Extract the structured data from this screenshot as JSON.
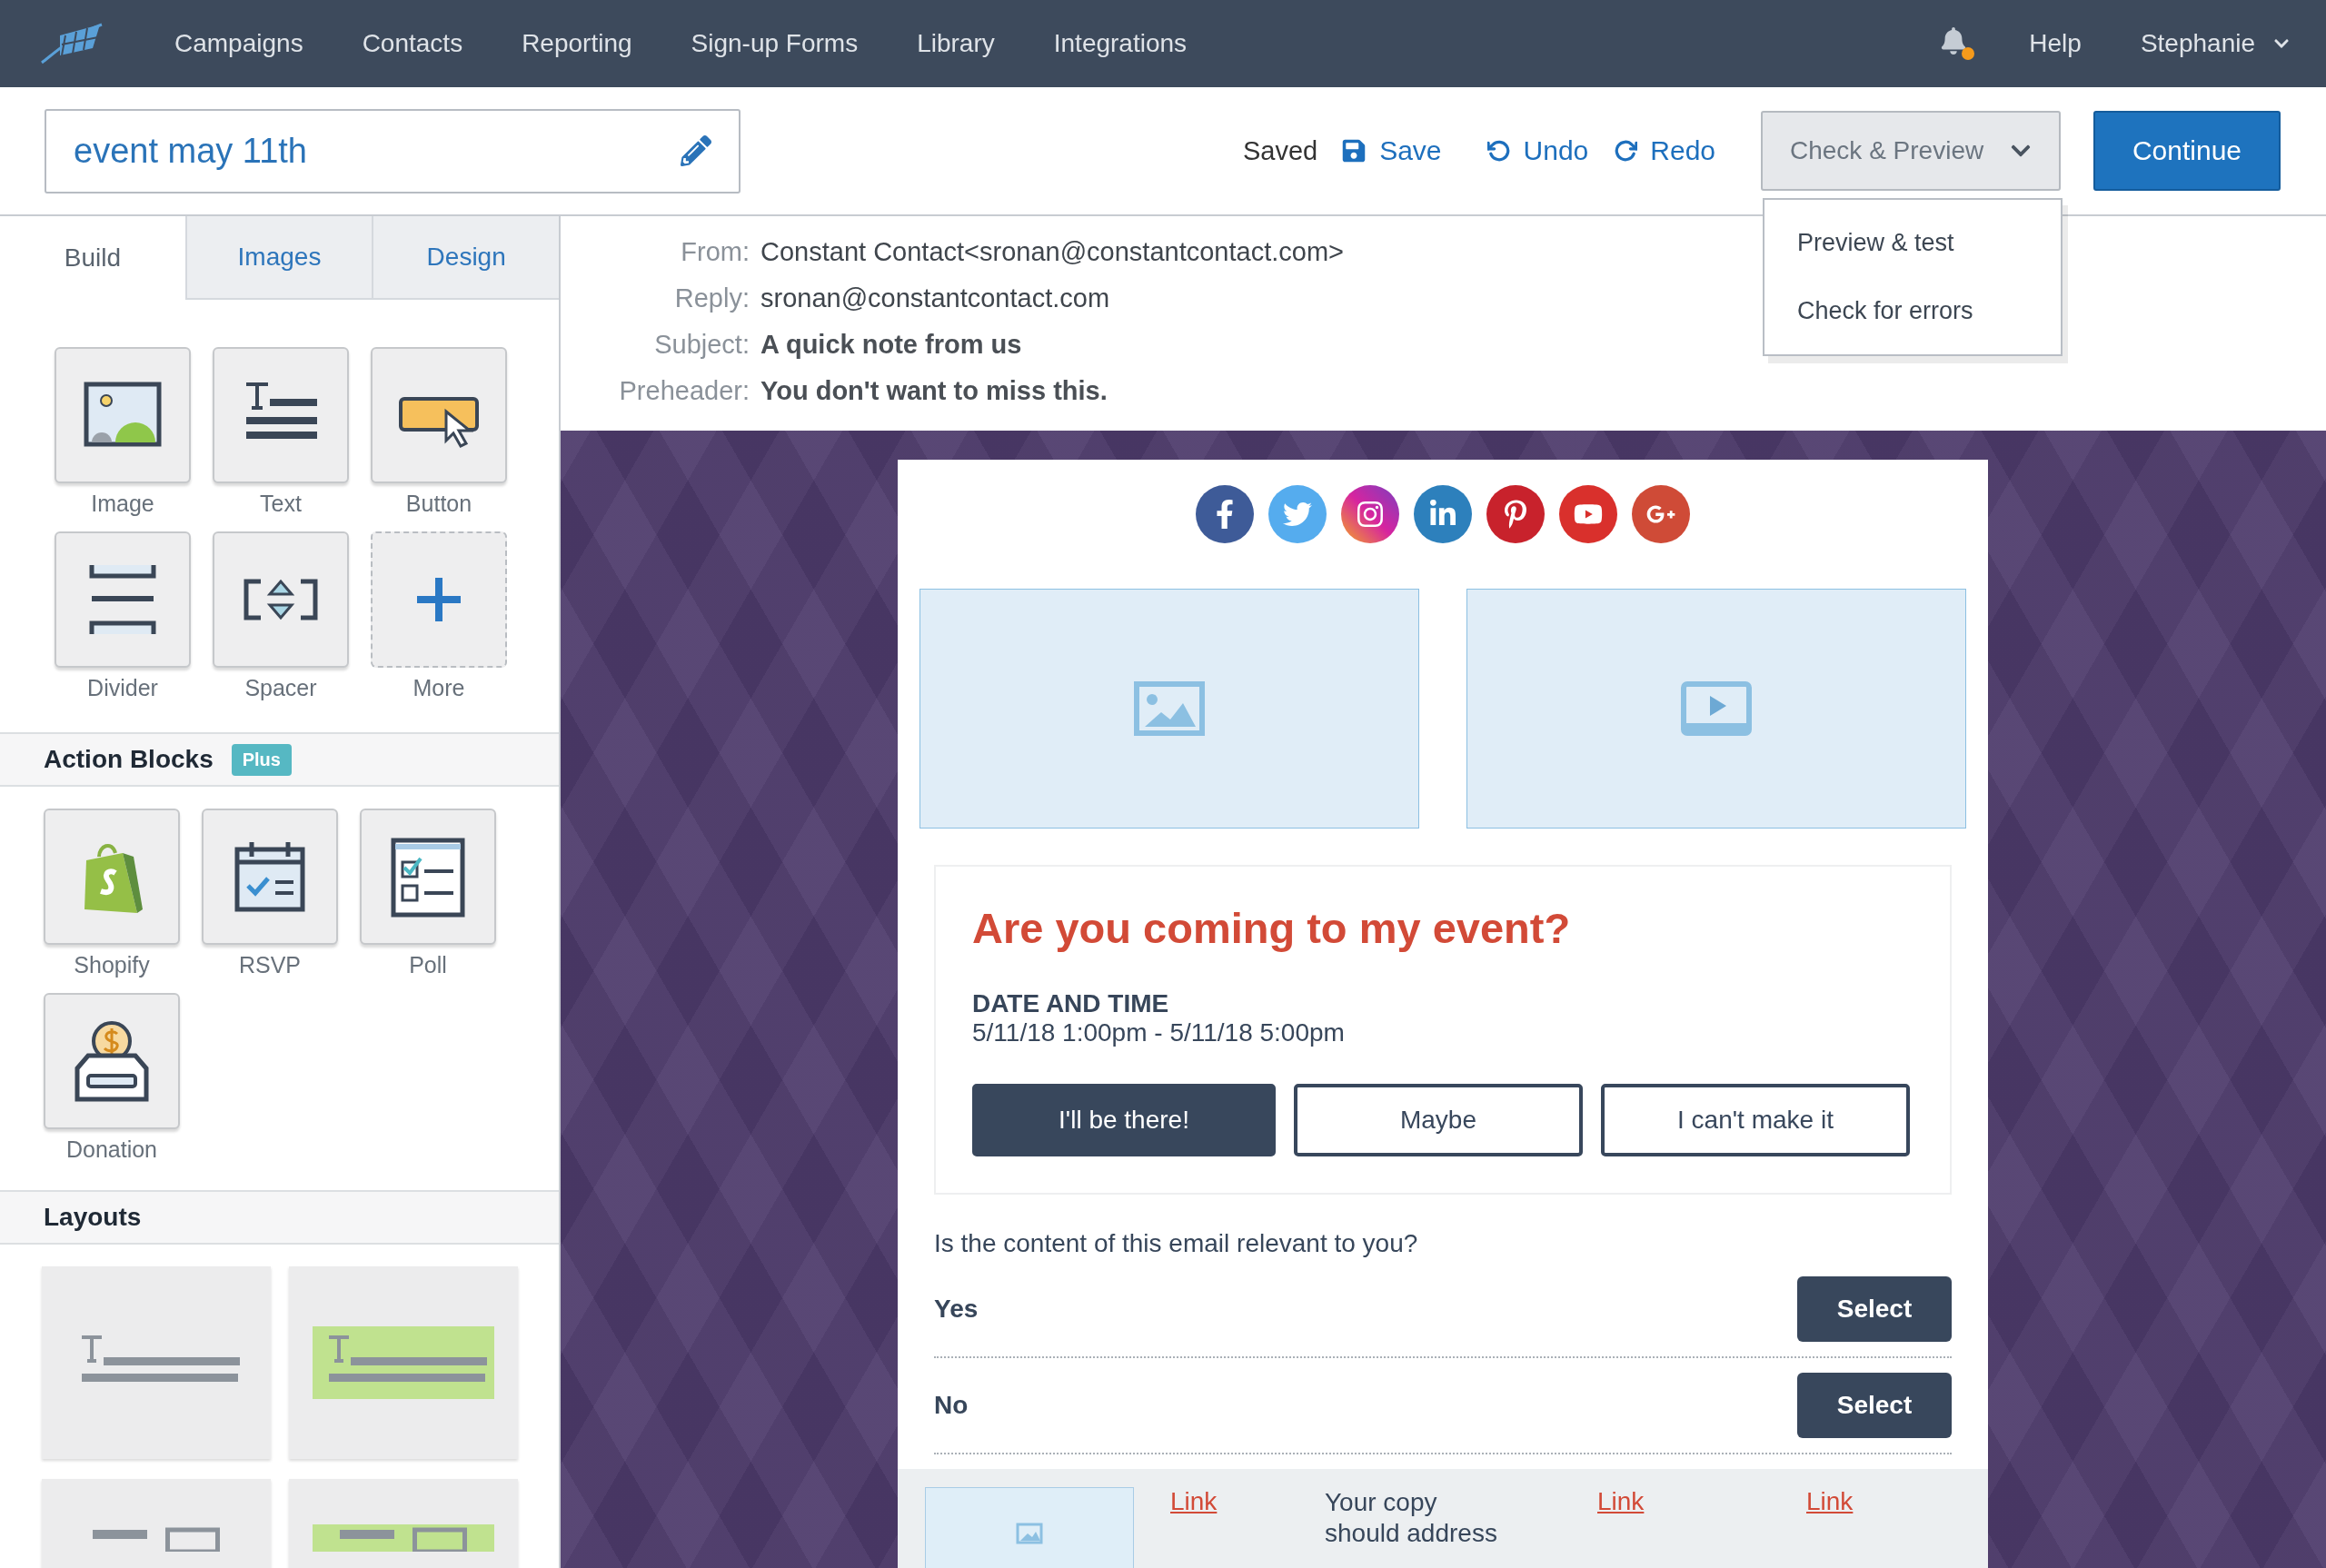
{
  "nav": {
    "items": [
      "Campaigns",
      "Contacts",
      "Reporting",
      "Sign-up Forms",
      "Library",
      "Integrations"
    ],
    "help": "Help",
    "user": "Stephanie"
  },
  "toolbar": {
    "title": "event may 11th",
    "status": "Saved",
    "save": "Save",
    "undo": "Undo",
    "redo": "Redo",
    "check_preview": "Check & Preview",
    "continue": "Continue"
  },
  "dropdown": {
    "expanded": true,
    "items": [
      "Preview & test",
      "Check for errors"
    ]
  },
  "sidebar": {
    "tabs": [
      {
        "label": "Build",
        "selected": true
      },
      {
        "label": "Images",
        "selected": false
      },
      {
        "label": "Design",
        "selected": false
      }
    ],
    "blocks": [
      {
        "kind": "image",
        "label": "Image"
      },
      {
        "kind": "text",
        "label": "Text"
      },
      {
        "kind": "button",
        "label": "Button"
      },
      {
        "kind": "divider",
        "label": "Divider"
      },
      {
        "kind": "spacer",
        "label": "Spacer"
      },
      {
        "kind": "more",
        "label": "More"
      }
    ],
    "action_blocks": {
      "title": "Action Blocks",
      "badge": "Plus",
      "items": [
        {
          "kind": "shopify",
          "label": "Shopify"
        },
        {
          "kind": "rsvp",
          "label": "RSVP"
        },
        {
          "kind": "poll",
          "label": "Poll"
        },
        {
          "kind": "donation",
          "label": "Donation"
        }
      ]
    },
    "layouts": {
      "title": "Layouts",
      "items": [
        {
          "kind": "plain"
        },
        {
          "kind": "highlighted"
        },
        {
          "kind": "plain-columns"
        },
        {
          "kind": "highlighted-columns"
        }
      ]
    }
  },
  "email_header": [
    {
      "label": "From:",
      "value": "Constant Contact<sronan@constantcontact.com>",
      "bold": false
    },
    {
      "label": "Reply:",
      "value": "sronan@constantcontact.com",
      "bold": false
    },
    {
      "label": "Subject:",
      "value": "A quick note from us",
      "bold": true
    },
    {
      "label": "Preheader:",
      "value": "You don't want to miss this.",
      "bold": true
    }
  ],
  "email": {
    "media": [
      {
        "kind": "image"
      },
      {
        "kind": "video"
      }
    ],
    "event": {
      "title": "Are you coming to my event?",
      "date_label": "DATE AND TIME",
      "date_value": "5/11/18 1:00pm - 5/11/18 5:00pm",
      "buttons": [
        {
          "label": "I'll be there!",
          "kind": "filled"
        },
        {
          "label": "Maybe",
          "kind": "outline"
        },
        {
          "label": "I can't make it",
          "kind": "outline"
        }
      ]
    },
    "poll": {
      "question": "Is the content of this email relevant to you?",
      "options": [
        {
          "label": "Yes",
          "button": "Select"
        },
        {
          "label": "No",
          "button": "Select"
        }
      ]
    },
    "footer": [
      {
        "kind": "image"
      },
      {
        "kind": "link",
        "text": "Link"
      },
      {
        "kind": "text",
        "text": "Your copy should address"
      },
      {
        "kind": "link",
        "text": "Link"
      },
      {
        "kind": "link",
        "text": "Link"
      }
    ]
  }
}
